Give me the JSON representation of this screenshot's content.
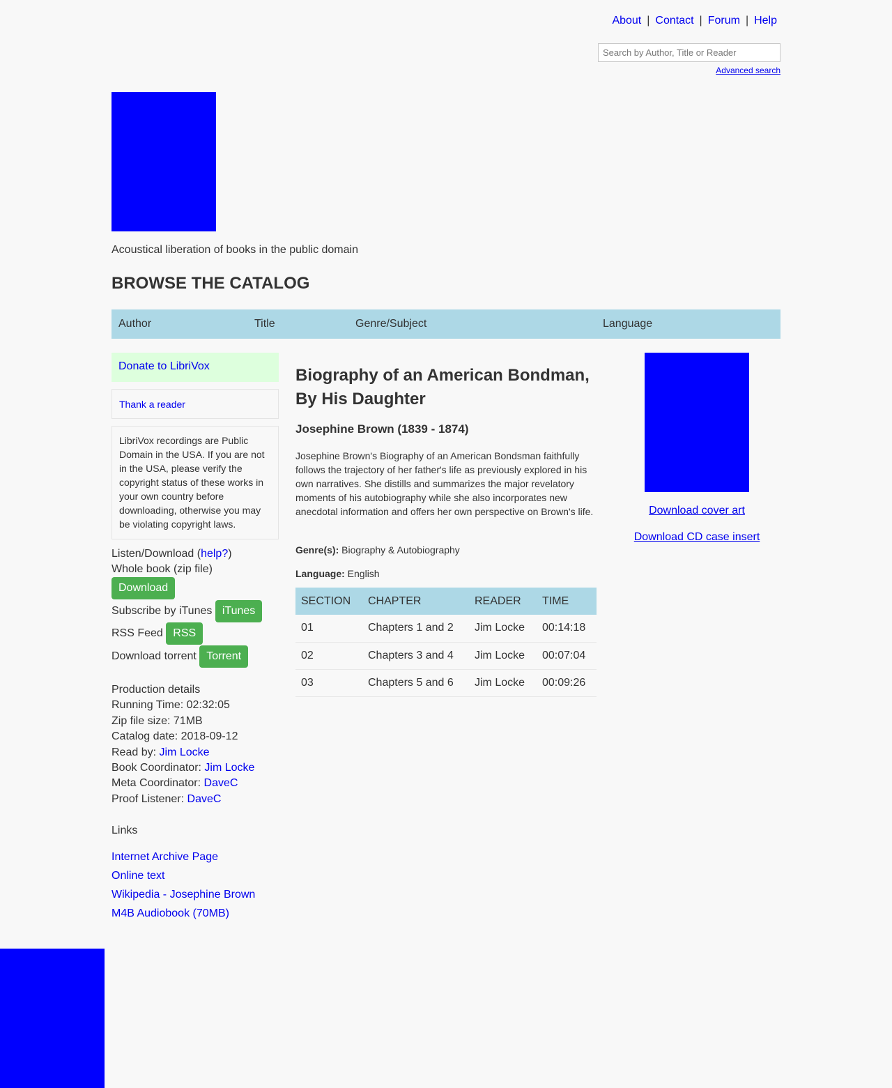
{
  "header": {
    "nav": [
      "About",
      "Contact",
      "Forum",
      "Help"
    ],
    "nav_separator": "|",
    "search_placeholder": "Search by Author, Title or Reader",
    "advanced_search": "Advanced search"
  },
  "site": {
    "tagline": "Acoustical liberation of books in the public domain",
    "browse_title": "BROWSE THE CATALOG",
    "catalog_tabs": [
      "Author",
      "Title",
      "Genre/Subject",
      "Language"
    ]
  },
  "sidebar": {
    "donate": "Donate to LibriVox",
    "thank_reader": "Thank a reader",
    "public_domain_notice": "LibriVox recordings are Public Domain in the USA. If you are not in the USA, please verify the copyright status of these works in your own country before downloading, otherwise you may be violating copyright laws.",
    "listen_download_label": "Listen/Download (",
    "help_link": "help?",
    "listen_download_close": ")",
    "whole_book_label": "Whole book (zip file)",
    "download_button": "Download",
    "itunes_label": "Subscribe by iTunes",
    "itunes_button": "iTunes",
    "rss_label": "RSS Feed",
    "rss_button": "RSS",
    "torrent_label": "Download torrent",
    "torrent_button": "Torrent"
  },
  "production": {
    "heading": "Production details",
    "running_time_label": "Running Time:",
    "running_time": "02:32:05",
    "zip_size_label": "Zip file size:",
    "zip_size": "71MB",
    "catalog_date_label": "Catalog date:",
    "catalog_date": "2018-09-12",
    "read_by_label": "Read by:",
    "read_by": "Jim Locke",
    "book_coordinator_label": "Book Coordinator:",
    "book_coordinator": "Jim Locke",
    "meta_coordinator_label": "Meta Coordinator:",
    "meta_coordinator": "DaveC",
    "proof_listener_label": "Proof Listener:",
    "proof_listener": "DaveC"
  },
  "links": {
    "heading": "Links",
    "items": [
      "Internet Archive Page",
      "Online text",
      "Wikipedia - Josephine Brown",
      "M4B Audiobook (70MB)"
    ]
  },
  "book": {
    "title": "Biography of an American Bondman, By His Daughter",
    "author": "Josephine Brown (1839 - 1874)",
    "description": "Josephine Brown's Biography of an American Bondsman faithfully follows the trajectory of her father's life as previously explored in his own narratives. She distills and summarizes the major revelatory moments of his autobiography while she also incorporates new anecdotal information and offers her own perspective on Brown's life.",
    "genre_label": "Genre(s):",
    "genre": "Biography & Autobiography",
    "language_label": "Language:",
    "language": "English"
  },
  "sections": {
    "headers": [
      "SECTION",
      "CHAPTER",
      "READER",
      "TIME"
    ],
    "rows": [
      [
        "01",
        "Chapters 1 and 2",
        "Jim Locke",
        "00:14:18"
      ],
      [
        "02",
        "Chapters 3 and 4",
        "Jim Locke",
        "00:07:04"
      ],
      [
        "03",
        "Chapters 5 and 6",
        "Jim Locke",
        "00:09:26"
      ]
    ]
  },
  "right": {
    "download_cover": "Download cover art",
    "download_cd_insert": "Download CD case insert"
  },
  "colors": {
    "background": "#f8f8f8",
    "link": "#0000ee",
    "catalog_bar": "#add8e6",
    "donate_bg": "#ddffdd",
    "button_green": "#4caf50",
    "image_placeholder": "#0000ff"
  }
}
